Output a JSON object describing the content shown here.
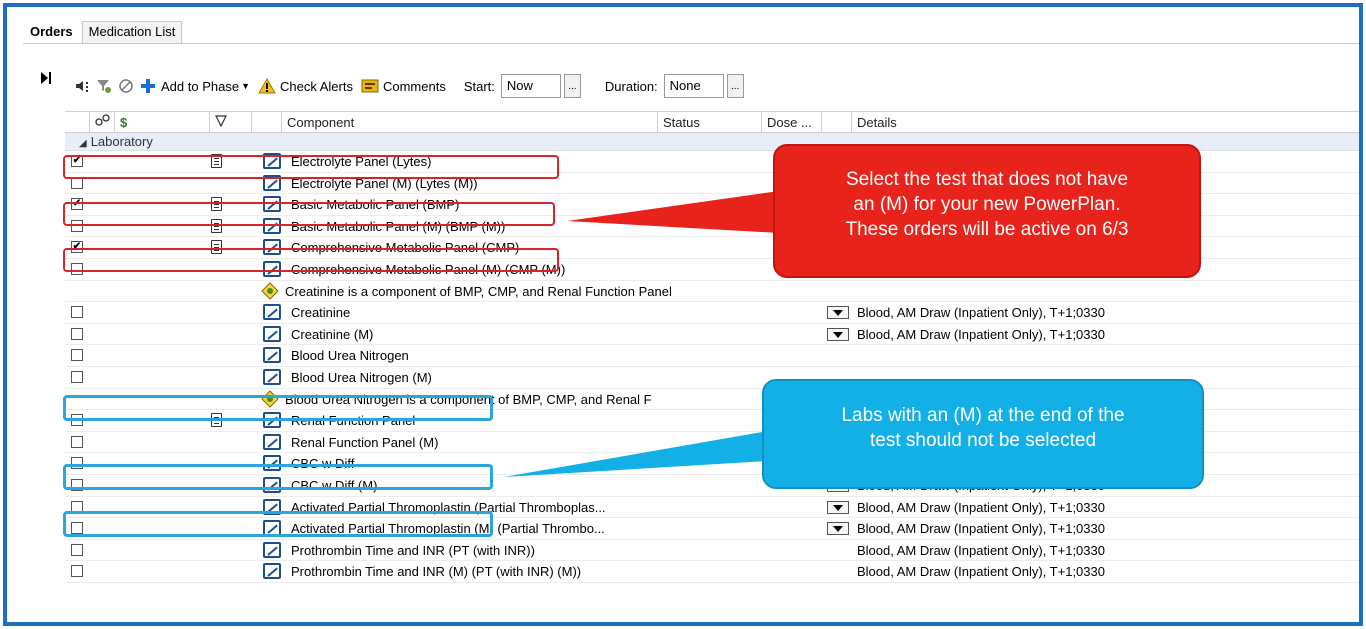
{
  "tabs": [
    {
      "label": "Orders",
      "active": true
    },
    {
      "label": "Medication List",
      "active": false
    }
  ],
  "toolbar": {
    "add_to_phase": "Add to Phase",
    "check_alerts": "Check Alerts",
    "comments": "Comments",
    "start_label": "Start:",
    "start_value": "Now",
    "duration_label": "Duration:",
    "duration_value": "None",
    "ellipsis": "..."
  },
  "columns": {
    "dollar": "$",
    "component": "Component",
    "status": "Status",
    "dose": "Dose ...",
    "details": "Details"
  },
  "section": "Laboratory",
  "rows": [
    {
      "checked": true,
      "doc": true,
      "icon": "order",
      "component": "Electrolyte Panel (Lytes)",
      "dropdown": false,
      "details": ""
    },
    {
      "checked": false,
      "doc": false,
      "icon": "order",
      "component": "Electrolyte Panel  (M) (Lytes  (M))",
      "dropdown": false,
      "details": ""
    },
    {
      "checked": true,
      "doc": true,
      "icon": "order",
      "component": "Basic Metabolic Panel (BMP)",
      "dropdown": false,
      "details": ""
    },
    {
      "checked": false,
      "doc": true,
      "icon": "order",
      "component": "Basic Metabolic Panel (M) (BMP (M))",
      "dropdown": false,
      "details": ""
    },
    {
      "checked": true,
      "doc": true,
      "icon": "order",
      "component": "Comprehensive Metabolic Panel (CMP)",
      "dropdown": false,
      "details": ""
    },
    {
      "checked": false,
      "doc": false,
      "icon": "order",
      "component": "Comprehensive Metabolic Panel (M) (CMP (M))",
      "dropdown": true,
      "details": "Blood, AM Draw (Inpatient Only), T+1;0330"
    },
    {
      "checkbox": false,
      "doc": false,
      "icon": "note",
      "component": "Creatinine is a component of BMP, CMP, and Renal Function Panel",
      "dropdown": false,
      "details": ""
    },
    {
      "checked": false,
      "doc": false,
      "icon": "order",
      "component": "Creatinine",
      "dropdown": true,
      "details": "Blood, AM Draw (Inpatient Only), T+1;0330"
    },
    {
      "checked": false,
      "doc": false,
      "icon": "order",
      "component": "Creatinine  (M)",
      "dropdown": true,
      "details": "Blood, AM Draw (Inpatient Only), T+1;0330"
    },
    {
      "checked": false,
      "doc": false,
      "icon": "order",
      "component": "Blood Urea Nitrogen",
      "dropdown": false,
      "details": ""
    },
    {
      "checked": false,
      "doc": false,
      "icon": "order",
      "component": "Blood Urea Nitrogen (M)",
      "dropdown": false,
      "details": ""
    },
    {
      "checkbox": false,
      "doc": false,
      "icon": "note",
      "component": "Blood Urea Nitrogen is a component of BMP, CMP, and Renal F",
      "dropdown": false,
      "details": ""
    },
    {
      "checked": false,
      "doc": true,
      "icon": "order",
      "component": "Renal Function Panel",
      "dropdown": false,
      "details": ""
    },
    {
      "checked": false,
      "doc": false,
      "icon": "order",
      "component": "Renal Function Panel  (M)",
      "dropdown": false,
      "details": ""
    },
    {
      "checked": false,
      "doc": false,
      "icon": "order",
      "component": "CBC w Diff",
      "dropdown": true,
      "details": "Blood, AM Draw (Inpatient Only), T+1;0330"
    },
    {
      "checked": false,
      "doc": false,
      "icon": "order",
      "component": "CBC w Diff (M)",
      "dropdown": true,
      "details": "Blood, AM Draw (Inpatient Only), T+1;0330"
    },
    {
      "checked": false,
      "doc": false,
      "icon": "order",
      "component": "Activated Partial Thromoplastin (Partial Thromboplas...",
      "dropdown": true,
      "details": "Blood, AM Draw (Inpatient Only), T+1;0330"
    },
    {
      "checked": false,
      "doc": false,
      "icon": "order",
      "component": "Activated Partial Thromoplastin (M) (Partial Thrombo...",
      "dropdown": true,
      "details": "Blood, AM Draw (Inpatient Only), T+1;0330"
    },
    {
      "checked": false,
      "doc": false,
      "icon": "order",
      "component": "Prothrombin Time and INR (PT (with INR))",
      "dropdown": false,
      "details": "Blood, AM Draw (Inpatient Only), T+1;0330"
    },
    {
      "checked": false,
      "doc": false,
      "icon": "order",
      "component": "Prothrombin Time and INR  (M) (PT (with INR)  (M))",
      "dropdown": false,
      "details": "Blood, AM Draw (Inpatient Only), T+1;0330"
    }
  ],
  "callouts": {
    "red": [
      "Select the test that does not have",
      "an (M) for your new PowerPlan.",
      "These orders will be active on 6/3"
    ],
    "blue": [
      "Labs with an (M) at the end of the",
      "test should not be selected"
    ]
  },
  "colors": {
    "frame": "#1e6fc2",
    "red_callout": "#e8231b",
    "blue_callout": "#13b0e8",
    "red_highlight": "#d8232a",
    "blue_highlight": "#2aa6dc"
  }
}
